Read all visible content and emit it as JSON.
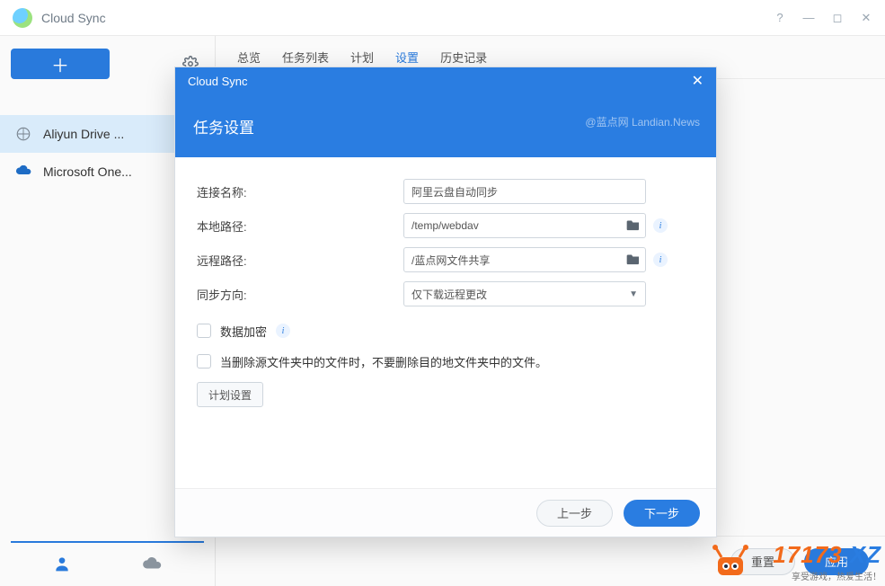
{
  "window": {
    "title": "Cloud Sync"
  },
  "sidebar": {
    "items": [
      {
        "label": "Aliyun Drive ...",
        "icon": "aliyun"
      },
      {
        "label": "Microsoft One...",
        "icon": "onedrive"
      }
    ]
  },
  "nav": {
    "items": [
      "总览",
      "任务列表",
      "计划",
      "设置",
      "历史记录"
    ],
    "active_index": 3
  },
  "footer": {
    "reset": "重置",
    "apply": "应用"
  },
  "modal": {
    "app_title": "Cloud Sync",
    "subtitle": "任务设置",
    "watermark": "@蓝点网 Landian.News",
    "labels": {
      "conn_name": "连接名称:",
      "local_path": "本地路径:",
      "remote_path": "远程路径:",
      "sync_dir": "同步方向:"
    },
    "values": {
      "conn_name": "阿里云盘自动同步",
      "local_path": "/temp/webdav",
      "remote_path": "/蓝点网文件共享",
      "sync_dir": "仅下载远程更改"
    },
    "checkboxes": {
      "encrypt": "数据加密",
      "dont_delete": "当删除源文件夹中的文件时，不要删除目的地文件夹中的文件。"
    },
    "schedule_btn": "计划设置",
    "prev": "上一步",
    "next": "下一步"
  },
  "corner": {
    "brand": "17173",
    "suffix": ".XZ",
    "tagline": "享受游戏，热爱生活！"
  }
}
